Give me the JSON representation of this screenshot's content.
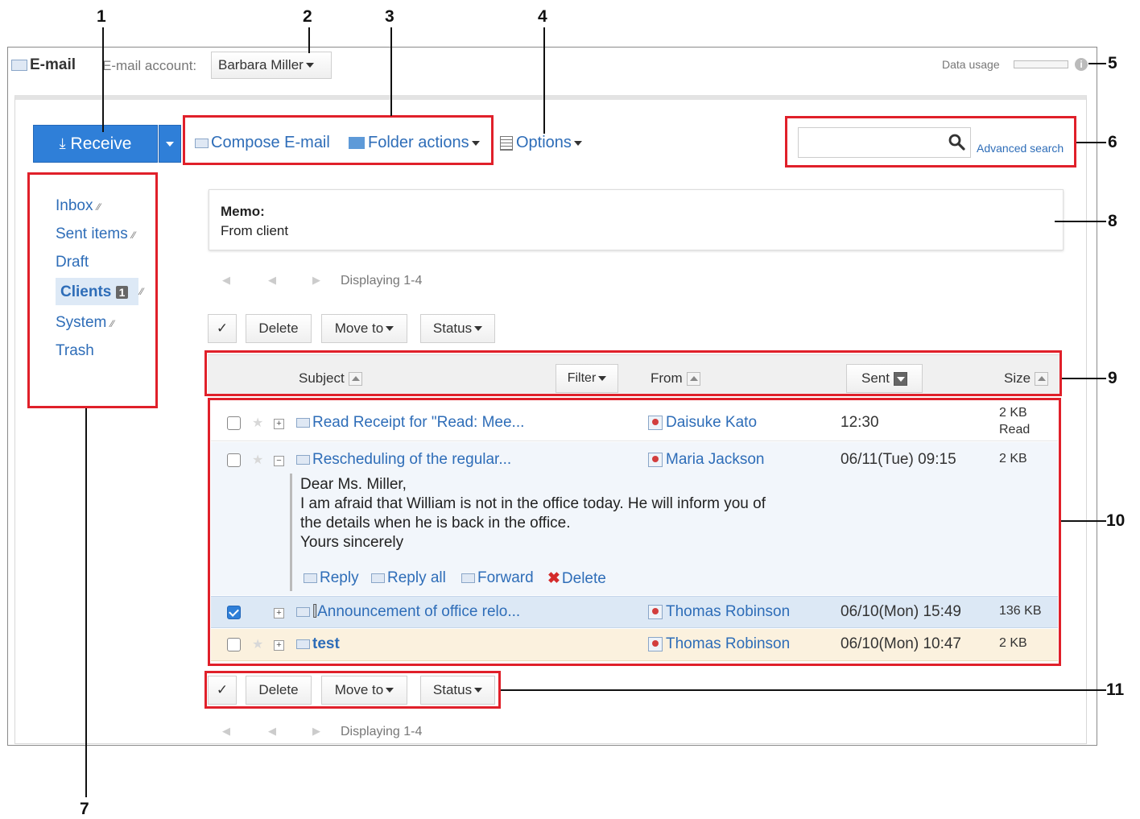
{
  "header": {
    "app_title": "E-mail",
    "account_label": "E-mail account:",
    "account_value": "Barbara Miller",
    "data_usage_label": "Data usage"
  },
  "toolbar": {
    "receive_label": "Receive",
    "compose_label": "Compose E-mail",
    "folder_actions_label": "Folder actions",
    "options_label": "Options",
    "search_placeholder": "",
    "advanced_search_label": "Advanced search"
  },
  "sidebar": {
    "items": [
      {
        "label": "Inbox"
      },
      {
        "label": "Sent items"
      },
      {
        "label": "Draft"
      },
      {
        "label": "Clients",
        "badge": "1"
      },
      {
        "label": "System"
      },
      {
        "label": "Trash"
      }
    ]
  },
  "memo": {
    "title": "Memo:",
    "text": "From client"
  },
  "pagination": {
    "top": "Displaying 1-4",
    "bottom": "Displaying 1-4"
  },
  "actions": {
    "check_symbol": "✓",
    "delete_label": "Delete",
    "move_label": "Move to",
    "status_label": "Status"
  },
  "columns": {
    "subject": "Subject",
    "filter": "Filter",
    "from": "From",
    "sent": "Sent",
    "size": "Size"
  },
  "emails": [
    {
      "subject": "Read Receipt for \"Read: Mee...",
      "from": "Daisuke Kato",
      "sent": "12:30",
      "size": "2 KB",
      "size_note": "Read",
      "checked": false
    },
    {
      "subject": "Rescheduling of the regular...",
      "from": "Maria Jackson",
      "sent": "06/11(Tue) 09:15",
      "size": "2 KB",
      "checked": false
    },
    {
      "subject": "Announcement of office relo...",
      "from": "Thomas Robinson",
      "sent": "06/10(Mon) 15:49",
      "size": "136 KB",
      "checked": true
    },
    {
      "subject": "test",
      "from": "Thomas Robinson",
      "sent": "06/10(Mon) 10:47",
      "size": "2 KB",
      "checked": false
    }
  ],
  "preview": {
    "line1": "Dear Ms. Miller,",
    "line2": "I am afraid that William is not in the office today. He will inform you of",
    "line3": "the details when he is back in the office.",
    "line4": "Yours sincerely",
    "reply_label": "Reply",
    "reply_all_label": "Reply all",
    "forward_label": "Forward",
    "delete_label": "Delete"
  },
  "callouts": [
    "1",
    "2",
    "3",
    "4",
    "5",
    "6",
    "7",
    "8",
    "9",
    "10",
    "11"
  ],
  "colors": {
    "accent": "#2f7fd8",
    "highlight_red": "#e0202a",
    "selected_row": "#dce8f5",
    "unread_row": "#fbf1de"
  }
}
